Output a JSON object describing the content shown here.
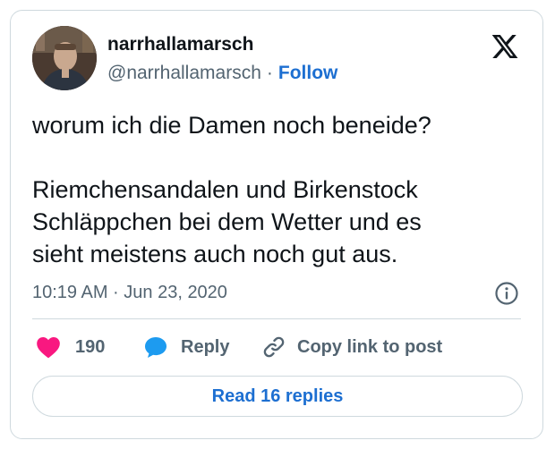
{
  "author": {
    "display_name": "narrhallamarsch",
    "handle": "@narrhallamarsch",
    "separator": "·",
    "follow_label": "Follow",
    "avatar_icon": "profile-photo"
  },
  "brand": {
    "logo_icon": "x-logo-icon"
  },
  "tweet": {
    "text": "worum ich die Damen noch beneide?\n\nRiemchensandalen und Birkenstock\nSchläppchen bei dem Wetter und es\nsieht meistens auch noch gut aus.",
    "timestamp": "10:19 AM · Jun 23, 2020"
  },
  "actions": {
    "like_count": "190",
    "reply_label": "Reply",
    "copy_link_label": "Copy link to post"
  },
  "footer": {
    "read_replies_label": "Read 16 replies"
  },
  "colors": {
    "link_blue": "#1d6fd1",
    "like_pink": "#f91880",
    "reply_blue": "#1d9bf0",
    "text_dark": "#0f1419",
    "text_muted": "#536471",
    "border": "#cfd9de"
  }
}
